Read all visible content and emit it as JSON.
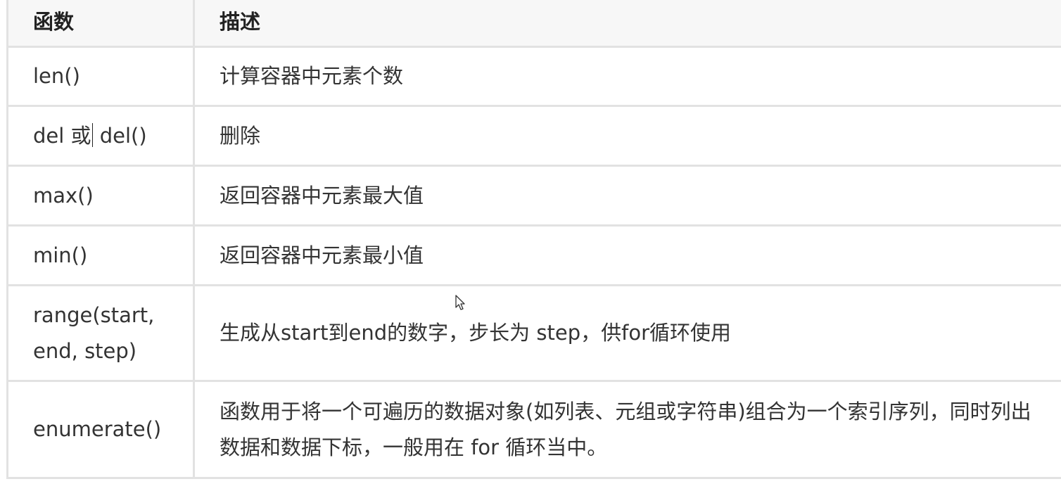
{
  "table": {
    "headers": {
      "function": "函数",
      "description": "描述"
    },
    "rows": [
      {
        "function": "len()",
        "description": "计算容器中元素个数"
      },
      {
        "function_before_caret": "del 或",
        "function_after_caret": " del()",
        "description": "删除"
      },
      {
        "function": "max()",
        "description": "返回容器中元素最大值"
      },
      {
        "function": "min()",
        "description": "返回容器中元素最小值"
      },
      {
        "function": "range(start, end, step)",
        "description": "生成从start到end的数字，步长为 step，供for循环使用"
      },
      {
        "function": "enumerate()",
        "description": "函数用于将一个可遍历的数据对象(如列表、元组或字符串)组合为一个索引序列，同时列出数据和数据下标，一般用在 for 循环当中。"
      }
    ]
  },
  "colors": {
    "border": "#e2e2e2",
    "header_background": "#f7f7f7",
    "text": "#333333"
  },
  "icons": {
    "mouse_cursor": "mouse-pointer-arrow-icon"
  }
}
